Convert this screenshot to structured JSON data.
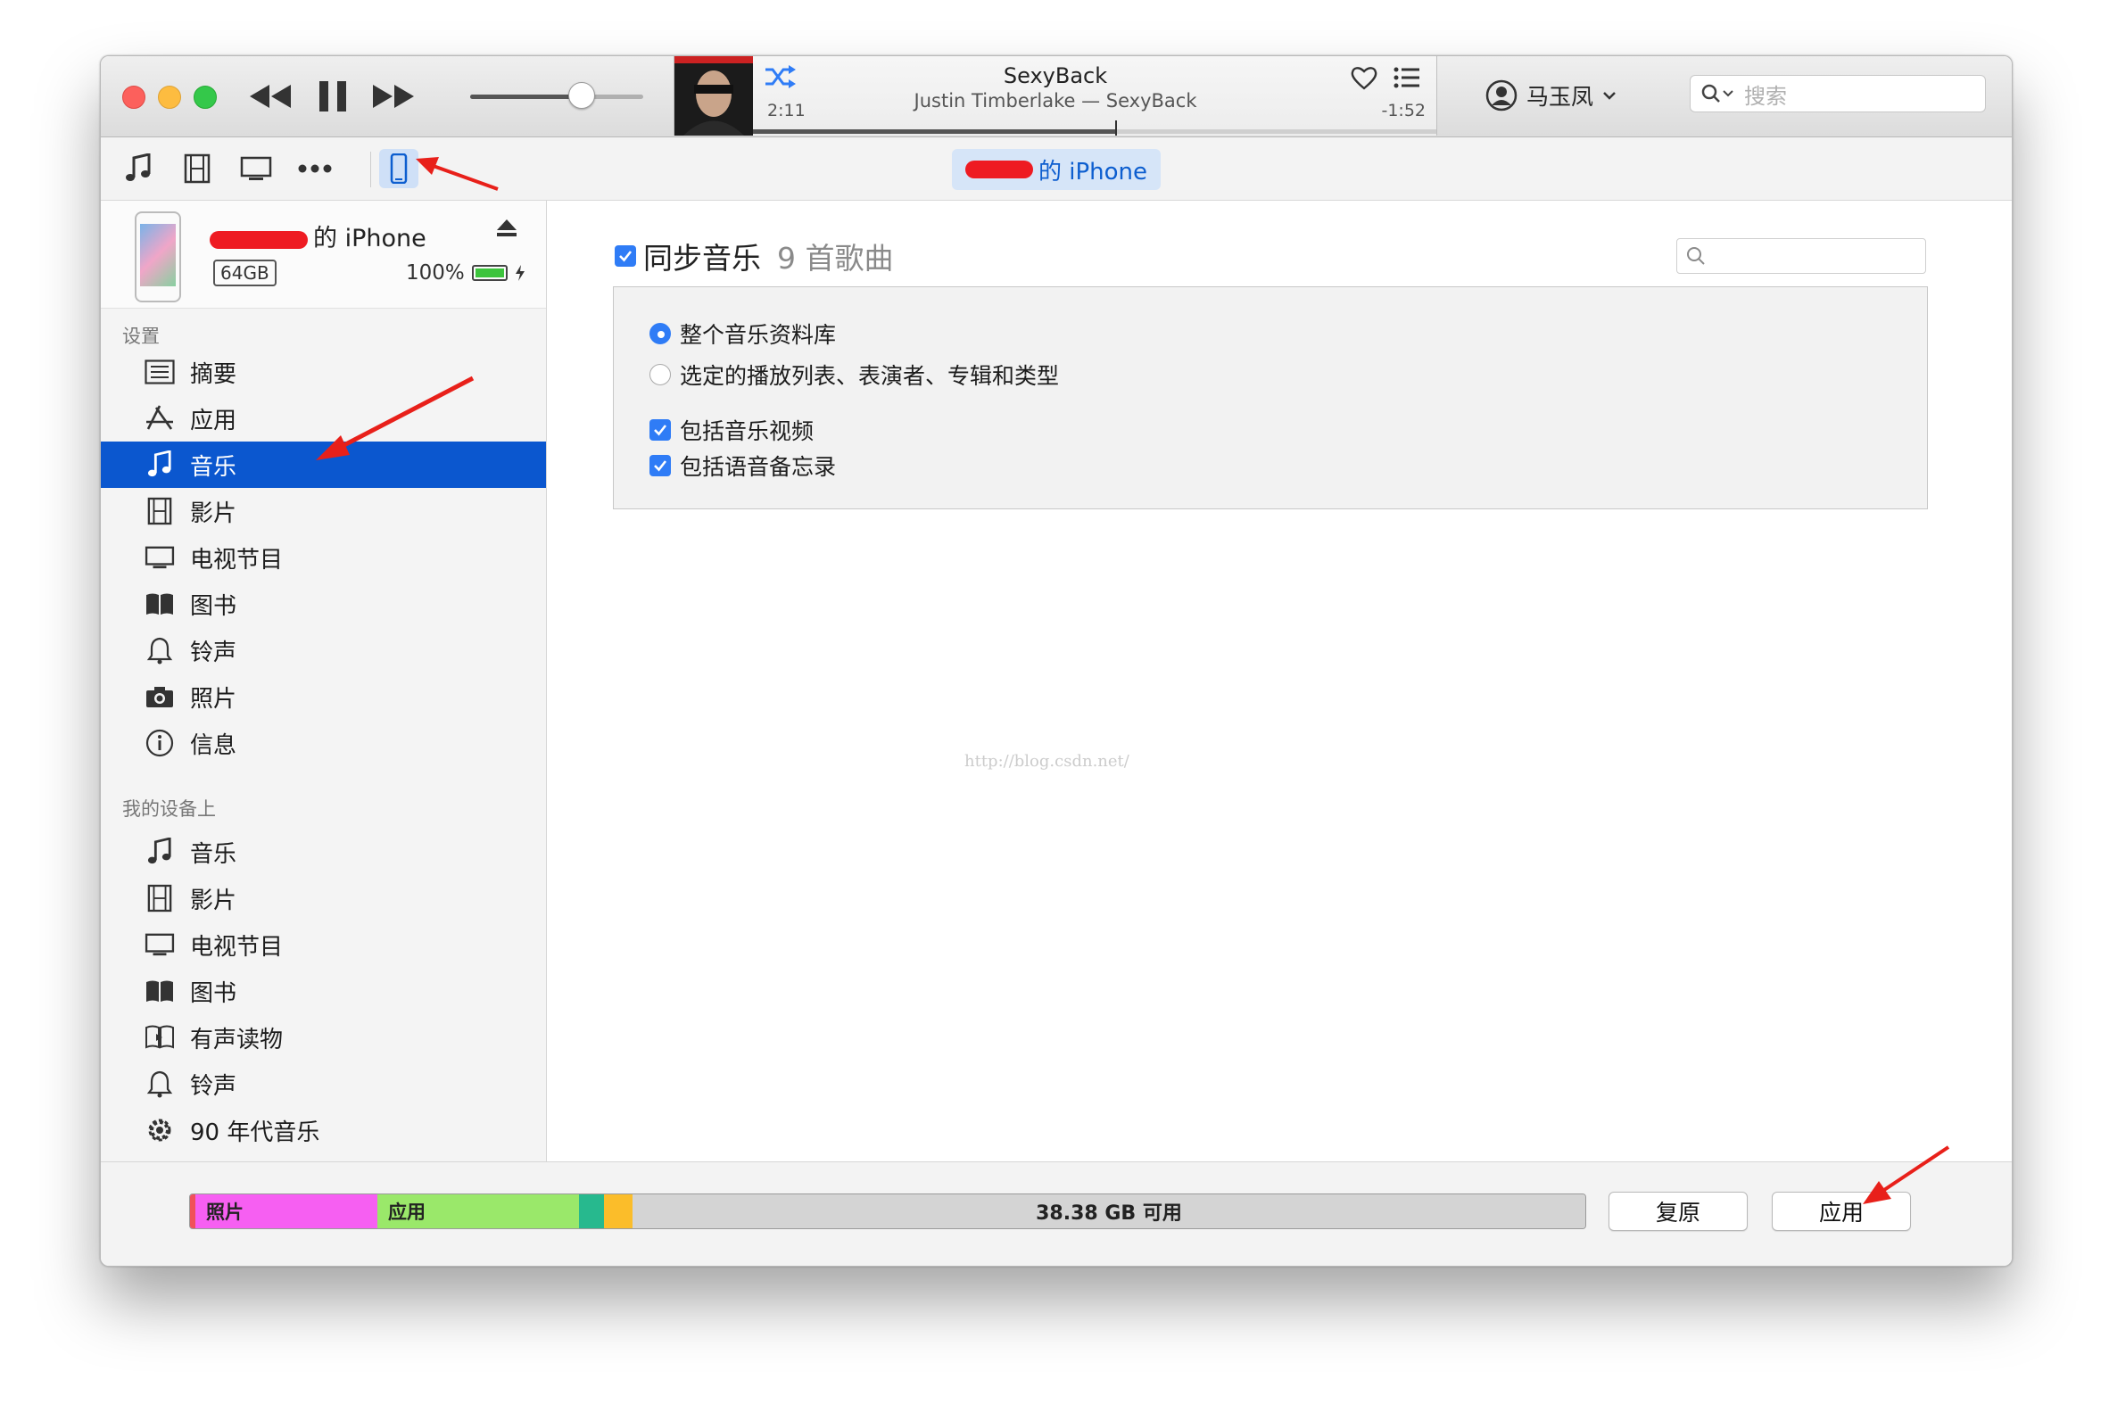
{
  "now_playing": {
    "title": "SexyBack",
    "subtitle": "Justin Timberlake — SexyBack",
    "elapsed": "2:11",
    "remaining": "-1:52",
    "progress": 0.53
  },
  "volume": 0.6,
  "account": {
    "name": "马玉凤"
  },
  "search": {
    "placeholder": "搜索"
  },
  "device_pill": {
    "label": "的 iPhone"
  },
  "device": {
    "name": "的 iPhone",
    "capacity": "64GB",
    "battery": "100%"
  },
  "sidebar": {
    "settings_header": "设置",
    "settings_items": [
      {
        "label": "摘要",
        "icon": "summary-list-icon"
      },
      {
        "label": "应用",
        "icon": "app-store-icon"
      },
      {
        "label": "音乐",
        "icon": "music-note-icon",
        "selected": true
      },
      {
        "label": "影片",
        "icon": "film-icon"
      },
      {
        "label": "电视节目",
        "icon": "tv-icon"
      },
      {
        "label": "图书",
        "icon": "book-icon"
      },
      {
        "label": "铃声",
        "icon": "bell-icon"
      },
      {
        "label": "照片",
        "icon": "camera-icon"
      },
      {
        "label": "信息",
        "icon": "info-icon"
      }
    ],
    "ondevice_header": "我的设备上",
    "ondevice_items": [
      {
        "label": "音乐",
        "icon": "music-note-icon"
      },
      {
        "label": "影片",
        "icon": "film-icon"
      },
      {
        "label": "电视节目",
        "icon": "tv-icon"
      },
      {
        "label": "图书",
        "icon": "book-icon"
      },
      {
        "label": "有声读物",
        "icon": "audiobook-icon"
      },
      {
        "label": "铃声",
        "icon": "bell-icon"
      },
      {
        "label": "90 年代音乐",
        "icon": "gear-icon"
      }
    ]
  },
  "sync": {
    "title": "同步音乐",
    "count": "9 首歌曲",
    "checked": true,
    "options": {
      "entire_library": "整个音乐资料库",
      "selected": "选定的播放列表、表演者、专辑和类型",
      "include_videos": "包括音乐视频",
      "include_memos": "包括语音备忘录"
    }
  },
  "watermark": "http://blog.csdn.net/",
  "storage": {
    "photos_label": "照片",
    "apps_label": "应用",
    "free_label": "38.38 GB 可用",
    "colors": {
      "photos": "#f65ff2",
      "apps": "#9ae86a",
      "other1": "#27b98e",
      "other2": "#fbbd2a",
      "free": "#d4d4d4"
    }
  },
  "buttons": {
    "revert": "复原",
    "apply": "应用"
  },
  "accent": "#0b57cf"
}
